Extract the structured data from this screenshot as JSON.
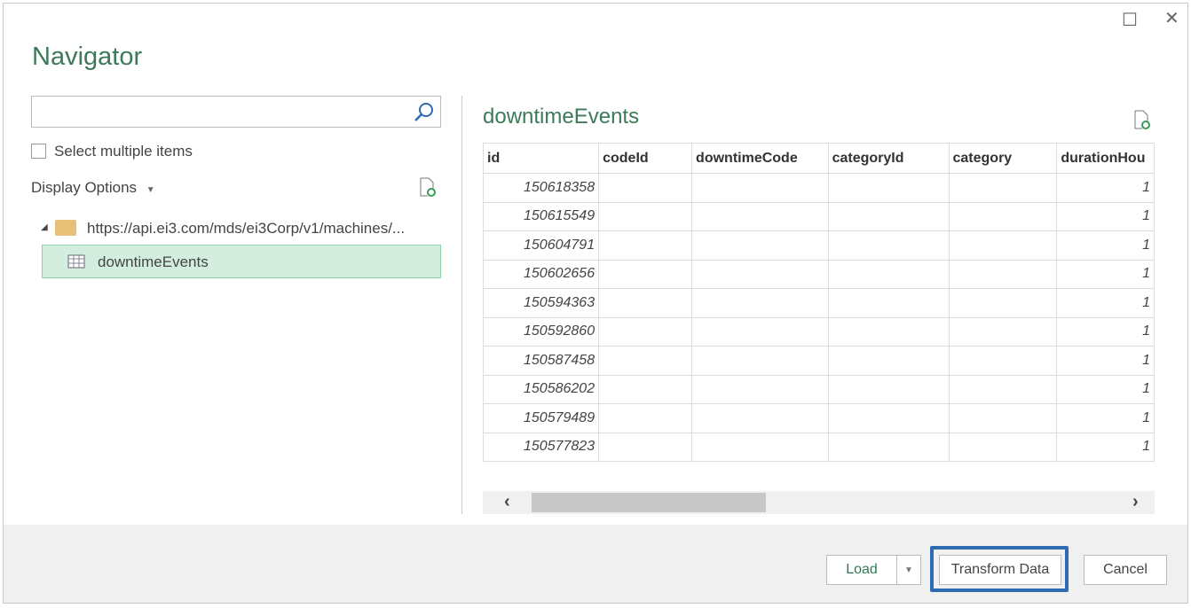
{
  "dialog": {
    "title": "Navigator",
    "maximize_icon": "maximize-icon",
    "close_icon": "close-icon"
  },
  "left": {
    "search": {
      "value": "",
      "placeholder": ""
    },
    "select_multiple": {
      "label": "Select multiple items",
      "checked": false
    },
    "display_options": "Display Options",
    "tree": {
      "folder": "https://api.ei3.com/mds/ei3Corp/v1/machines/...",
      "items": [
        {
          "label": "downtimeEvents",
          "selected": true
        }
      ]
    }
  },
  "preview": {
    "title": "downtimeEvents",
    "columns": [
      "id",
      "codeId",
      "downtimeCode",
      "categoryId",
      "category",
      "durationHou"
    ],
    "rows": [
      [
        "150618358",
        "",
        "",
        "",
        "",
        "1"
      ],
      [
        "150615549",
        "",
        "",
        "",
        "",
        "1"
      ],
      [
        "150604791",
        "",
        "",
        "",
        "",
        "1"
      ],
      [
        "150602656",
        "",
        "",
        "",
        "",
        "1"
      ],
      [
        "150594363",
        "",
        "",
        "",
        "",
        "1"
      ],
      [
        "150592860",
        "",
        "",
        "",
        "",
        "1"
      ],
      [
        "150587458",
        "",
        "",
        "",
        "",
        "1"
      ],
      [
        "150586202",
        "",
        "",
        "",
        "",
        "1"
      ],
      [
        "150579489",
        "",
        "",
        "",
        "",
        "1"
      ],
      [
        "150577823",
        "",
        "",
        "",
        "",
        "1"
      ]
    ]
  },
  "footer": {
    "load": "Load",
    "transform": "Transform Data",
    "cancel": "Cancel"
  },
  "colors": {
    "accent": "#3c7a5a",
    "selected_bg": "#d3eedf",
    "highlight_border": "#2e6bb0"
  }
}
